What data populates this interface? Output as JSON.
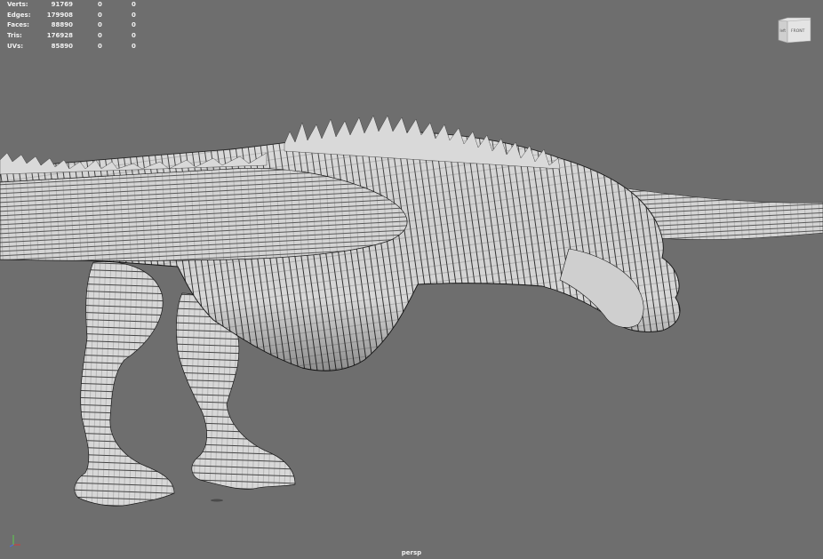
{
  "hud": {
    "rows": [
      {
        "label": "Verts:",
        "v1": "91769",
        "v2": "0",
        "v3": "0"
      },
      {
        "label": "Edges:",
        "v1": "179908",
        "v2": "0",
        "v3": "0"
      },
      {
        "label": "Faces:",
        "v1": "88890",
        "v2": "0",
        "v3": "0"
      },
      {
        "label": "Tris:",
        "v1": "176928",
        "v2": "0",
        "v3": "0"
      },
      {
        "label": "UVs:",
        "v1": "85890",
        "v2": "0",
        "v3": "0"
      }
    ]
  },
  "viewcube": {
    "left_face": "left",
    "front_face": "FRONT"
  },
  "camera": {
    "label": "persp"
  },
  "colors": {
    "background": "#6e6e6e",
    "mesh": "#d8d8d8",
    "wire": "#1e1e1e",
    "hud_text": "#f2f2f2",
    "axis_x": "#d63b3b",
    "axis_y": "#5fcf4f",
    "axis_z": "#4a6fe0"
  }
}
